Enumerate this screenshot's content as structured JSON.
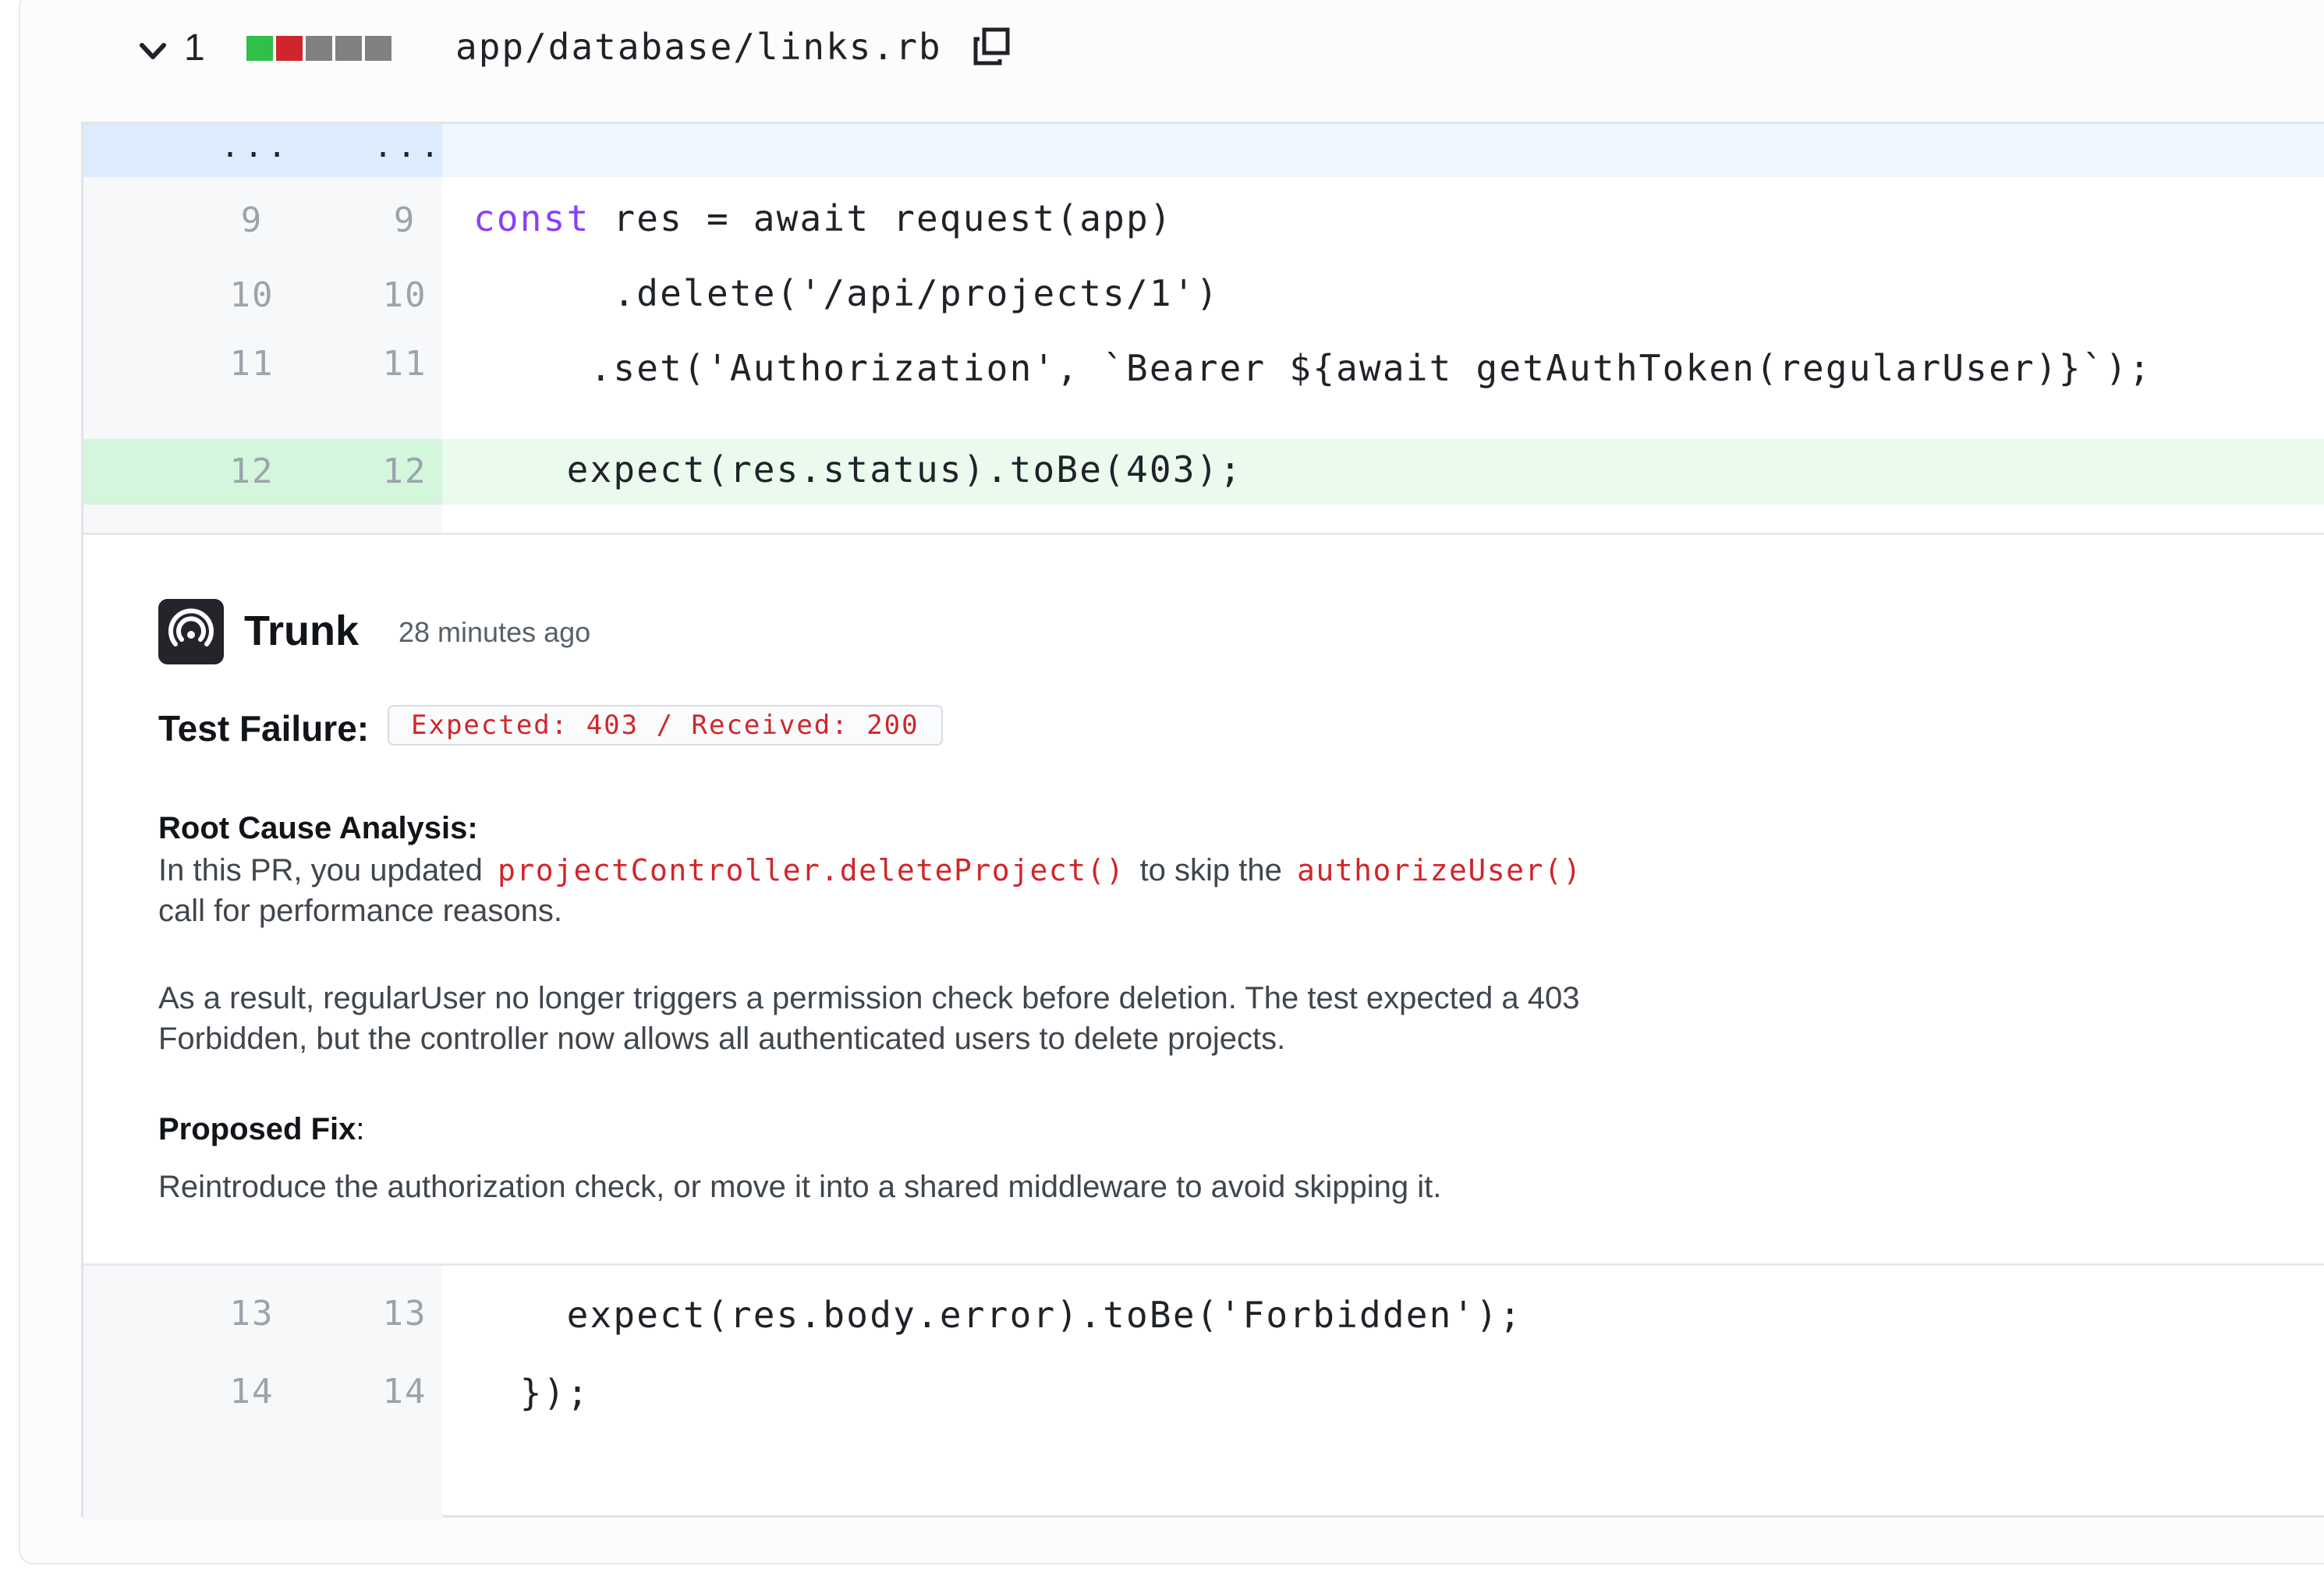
{
  "file": {
    "change_count": "1",
    "path": "app/database/links.rb",
    "diffstat_colors": [
      "#2fbf4a",
      "#d0262b",
      "#808080",
      "#808080",
      "#808080"
    ]
  },
  "hunk": {
    "old": "...",
    "new": "..."
  },
  "lines": [
    {
      "old": "9",
      "new": "9",
      "kw": "const",
      "code": " res = await request(app)"
    },
    {
      "old": "10",
      "new": "10",
      "code": "      .delete('/api/projects/1')"
    },
    {
      "old": "11",
      "new": "11",
      "code": "     .set('Authorization', `Bearer ${await getAuthToken(regularUser)}`);"
    },
    {
      "old": "12",
      "new": "12",
      "code": "    expect(res.status).toBe(403);"
    },
    {
      "old": "13",
      "new": "13",
      "code": "    expect(res.body.error).toBe('Forbidden');"
    },
    {
      "old": "14",
      "new": "14",
      "code": "  });"
    }
  ],
  "comment": {
    "author": "Trunk",
    "time": "28 minutes ago",
    "failure_label": "Test Failure:",
    "failure_detail": "Expected: 403 / Received: 200",
    "rca_title": "Root Cause Analysis:",
    "p1_a": "In this PR, you updated",
    "p1_code1": "projectController.deleteProject()",
    "p1_b": "to skip the",
    "p1_code2": "authorizeUser()",
    "p1_c": "call for performance reasons.",
    "p2": "As a result, regularUser no longer triggers a permission check before deletion. The test expected a 403 Forbidden, but the controller now allows all authenticated users to delete projects.",
    "fix_title": "Proposed Fix",
    "fix_colon": ":",
    "p3": "Reintroduce the authorization check, or move it into a shared middleware to avoid skipping it."
  }
}
